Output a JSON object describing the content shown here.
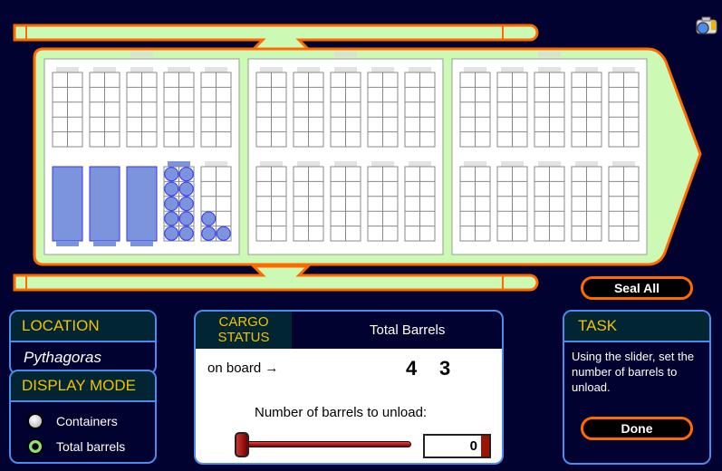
{
  "colors": {
    "background": "#020230",
    "hull": "#ccfab4",
    "hull_border": "#ff6a00",
    "panel_border": "#4a8cf0",
    "header_text": "#f2c200",
    "container_fill": "#7b94dc",
    "barrel_stroke": "#3333ff"
  },
  "toolbar": {
    "camera_icon": "camera-icon"
  },
  "ship": {
    "bays": [
      {
        "top": [
          0,
          0,
          0,
          0,
          0
        ],
        "bottom": [
          {
            "barrels": 10,
            "sealed": true
          },
          {
            "barrels": 10,
            "sealed": true
          },
          {
            "barrels": 10,
            "sealed": true
          },
          {
            "barrels": 10,
            "sealed": false
          },
          {
            "barrels": 3,
            "sealed": false
          }
        ]
      },
      {
        "top": [
          0,
          0,
          0,
          0,
          0
        ],
        "bottom": [
          {
            "barrels": 0
          },
          {
            "barrels": 0
          },
          {
            "barrels": 0
          },
          {
            "barrels": 0
          },
          {
            "barrels": 0
          }
        ]
      },
      {
        "top": [
          0,
          0,
          0,
          0,
          0
        ],
        "bottom": [
          {
            "barrels": 0
          },
          {
            "barrels": 0
          },
          {
            "barrels": 0
          },
          {
            "barrels": 0
          },
          {
            "barrels": 0
          }
        ]
      }
    ]
  },
  "buttons": {
    "seal_all": "Seal All",
    "done": "Done"
  },
  "location": {
    "header": "LOCATION",
    "value": "Pythagoras"
  },
  "display_mode": {
    "header": "DISPLAY MODE",
    "options": [
      {
        "label": "Containers",
        "selected": false
      },
      {
        "label": "Total barrels",
        "selected": true
      }
    ]
  },
  "cargo": {
    "header": "CARGO STATUS",
    "column": "Total Barrels",
    "row_label": "on board →",
    "tens": "4",
    "ones": "3",
    "unload_label": "Number of barrels to unload:",
    "unload_value": "0",
    "slider_fraction": 0
  },
  "task": {
    "header": "TASK",
    "text": "Using the slider, set the number of barrels to unload."
  }
}
